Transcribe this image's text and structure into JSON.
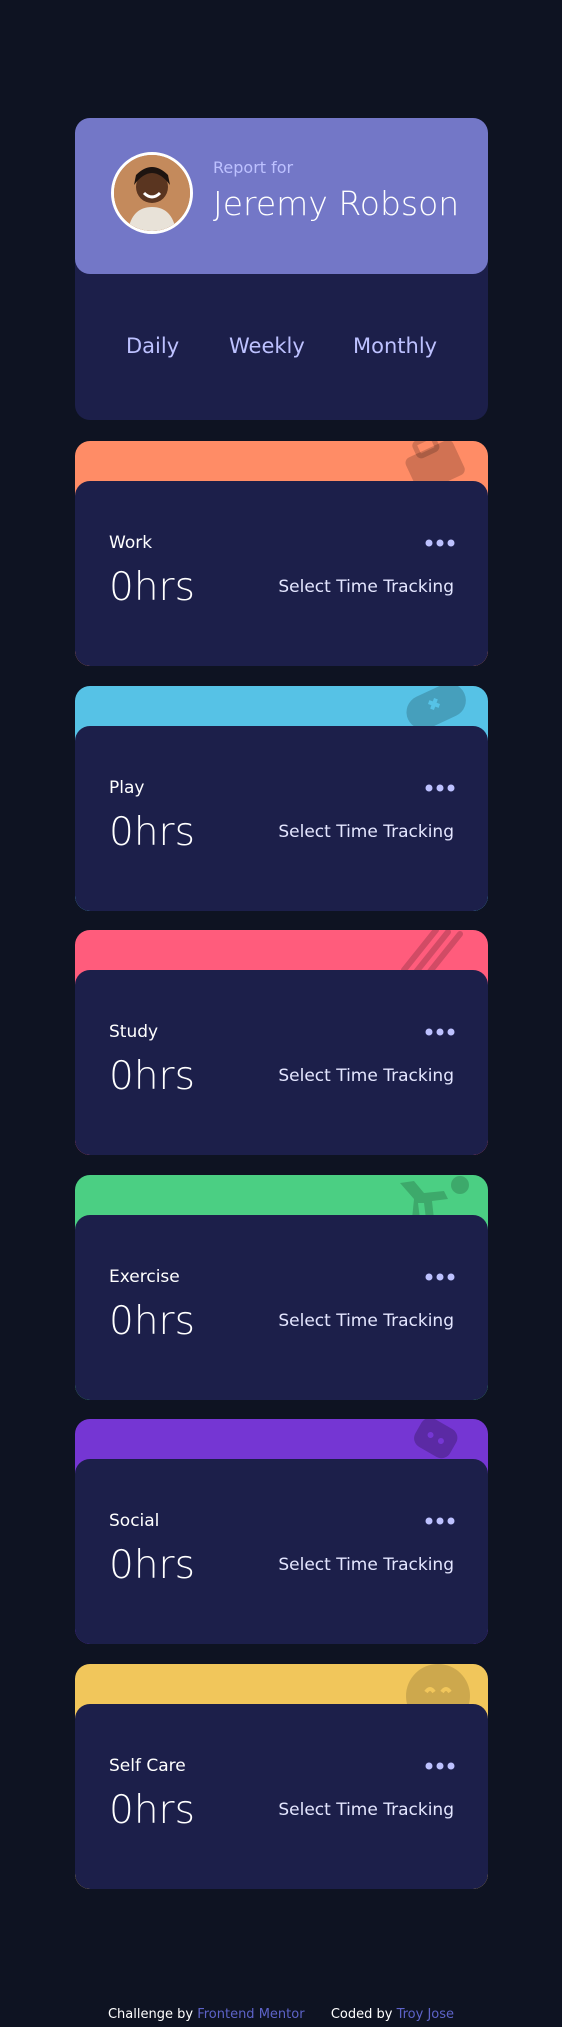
{
  "profile": {
    "report_for": "Report for",
    "name": "Jeremy Robson"
  },
  "tabs": {
    "daily": "Daily",
    "weekly": "Weekly",
    "monthly": "Monthly"
  },
  "cards": [
    {
      "title": "Work",
      "hours": "0hrs",
      "previous": "Select Time Tracking",
      "color": "#ff8c66",
      "icon": "briefcase-icon"
    },
    {
      "title": "Play",
      "hours": "0hrs",
      "previous": "Select Time Tracking",
      "color": "#56c2e6",
      "icon": "gamepad-icon"
    },
    {
      "title": "Study",
      "hours": "0hrs",
      "previous": "Select Time Tracking",
      "color": "#ff5c7c",
      "icon": "book-icon"
    },
    {
      "title": "Exercise",
      "hours": "0hrs",
      "previous": "Select Time Tracking",
      "color": "#4bcf83",
      "icon": "running-icon"
    },
    {
      "title": "Social",
      "hours": "0hrs",
      "previous": "Select Time Tracking",
      "color": "#7536d3",
      "icon": "chat-icon"
    },
    {
      "title": "Self Care",
      "hours": "0hrs",
      "previous": "Select Time Tracking",
      "color": "#f1c65b",
      "icon": "smiley-icon"
    }
  ],
  "footer": {
    "challenge_prefix": "Challenge by",
    "challenge_link": "Frontend Mentor",
    "coded_prefix": "Coded by",
    "coded_link": "Troy Jose"
  }
}
